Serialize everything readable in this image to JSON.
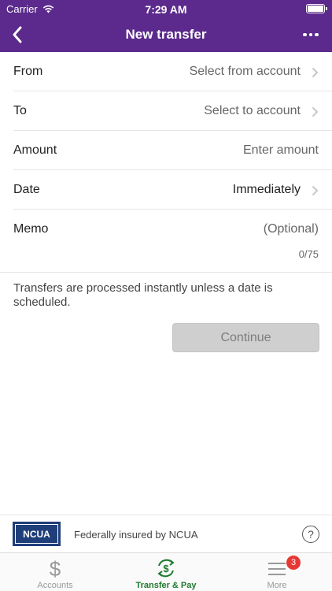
{
  "status": {
    "carrier": "Carrier",
    "time": "7:29 AM"
  },
  "nav": {
    "title": "New transfer"
  },
  "form": {
    "from": {
      "label": "From",
      "value": "Select from account"
    },
    "to": {
      "label": "To",
      "value": "Select to account"
    },
    "amount": {
      "label": "Amount",
      "placeholder": "Enter amount"
    },
    "date": {
      "label": "Date",
      "value": "Immediately"
    },
    "memo": {
      "label": "Memo",
      "placeholder": "(Optional)",
      "counter": "0/75"
    }
  },
  "info_text": "Transfers are processed instantly unless a date is scheduled.",
  "continue_label": "Continue",
  "ncua": {
    "logo_text": "NCUA",
    "text": "Federally insured by NCUA",
    "help": "?"
  },
  "tabs": [
    {
      "label": "Accounts",
      "icon": "dollar-icon"
    },
    {
      "label": "Transfer & Pay",
      "icon": "transfer-pay-icon"
    },
    {
      "label": "More",
      "icon": "menu-icon",
      "badge": "3"
    }
  ],
  "colors": {
    "header": "#5b2a8c",
    "active_tab": "#1e7a2e",
    "badge": "#e53935"
  }
}
